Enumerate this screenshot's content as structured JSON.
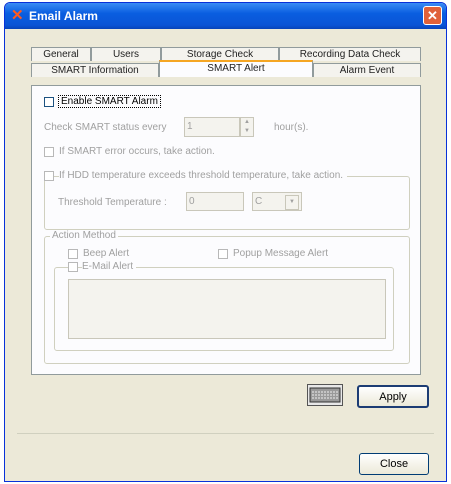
{
  "window": {
    "title": "Email Alarm"
  },
  "tabs": {
    "row1": [
      "General",
      "Users",
      "Storage Check",
      "Recording Data Check"
    ],
    "row2": [
      "SMART Information",
      "SMART Alert",
      "Alarm Event"
    ]
  },
  "smart_alert": {
    "enable_label": "Enable SMART Alarm",
    "check_status_label": "Check SMART status every",
    "check_status_value": "1",
    "hours_label": "hour(s).",
    "error_label": "If SMART error occurs, take action.",
    "temp_label": "If HDD temperature exceeds threshold temperature, take action.",
    "threshold_label": "Threshold Temperature :",
    "threshold_value": "0",
    "unit_value": "C"
  },
  "action_method": {
    "title": "Action Method",
    "beep_label": "Beep Alert",
    "popup_label": "Popup Message Alert",
    "email_label": "E-Mail Alert"
  },
  "buttons": {
    "apply": "Apply",
    "close": "Close"
  },
  "icons": {
    "app": "network-alarm-icon",
    "close": "close-icon",
    "keyboard": "keyboard-icon"
  }
}
